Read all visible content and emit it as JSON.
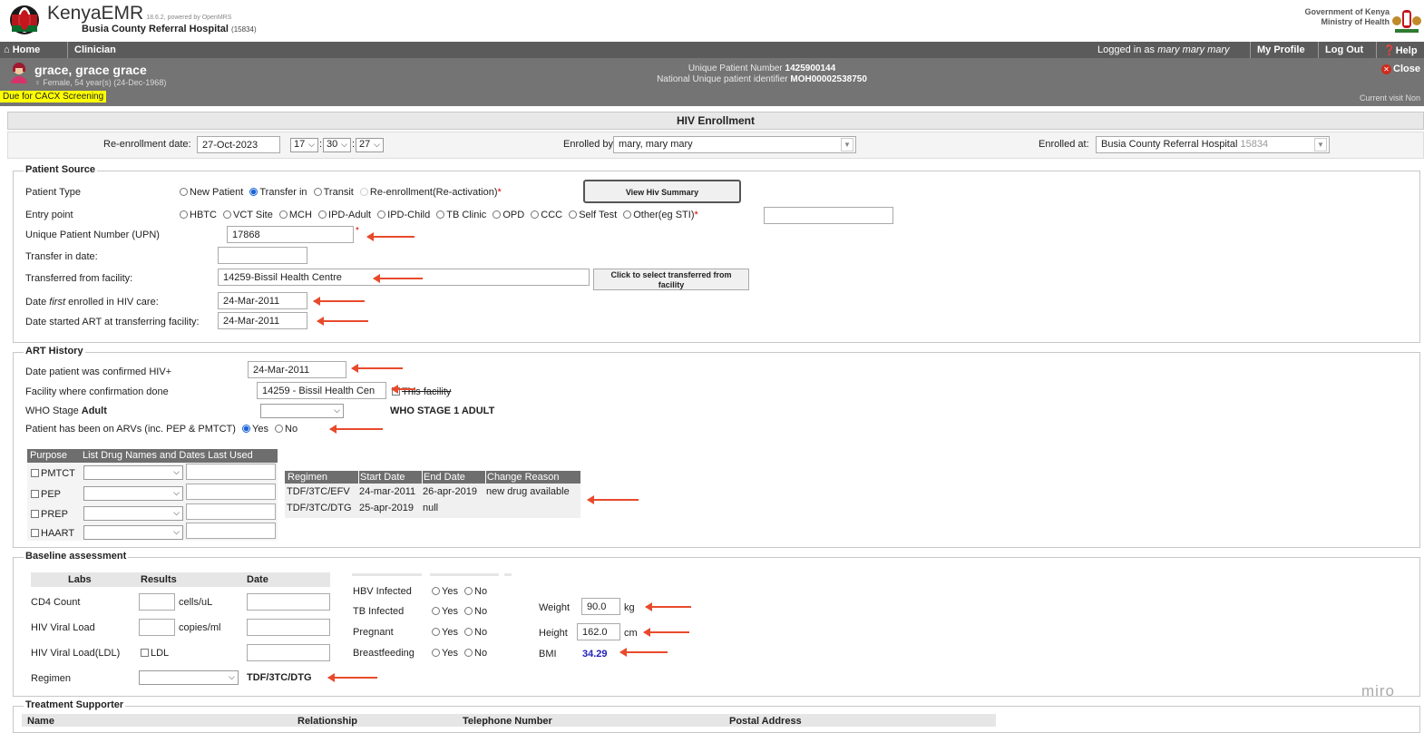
{
  "header": {
    "app_name": "KenyaEMR",
    "version": "18.6.2, powered by OpenMRS",
    "hospital": "Busia County Referral Hospital",
    "hospital_code": "(15834)",
    "gov_line1": "Government of Kenya",
    "gov_line2": "Ministry of Health"
  },
  "nav": {
    "home": "Home",
    "clinician": "Clinician",
    "logged_in_prefix": "Logged in as",
    "user": "mary mary mary",
    "my_profile": "My Profile",
    "logout": "Log Out",
    "help": "Help"
  },
  "patient": {
    "name": "grace, grace grace",
    "demographics": "Female, 54 year(s) (24-Dec-1968)",
    "upn_label": "Unique Patient Number",
    "upn_value": "1425900144",
    "nupi_label": "National Unique patient identifier",
    "nupi_value": "MOH00002538750",
    "alert": "Due for CACX Screening",
    "close": "Close",
    "current_visit": "Current visit Non"
  },
  "form": {
    "title": "HIV Enrollment",
    "reenroll_label": "Re-enrollment date:",
    "reenroll_date": "27-Oct-2023",
    "hour": "17",
    "minute": "30",
    "second": "27",
    "enrolled_by_label": "Enrolled by:",
    "enrolled_by": "mary, mary mary",
    "enrolled_at_label": "Enrolled at:",
    "enrolled_at": "Busia County Referral Hospital",
    "enrolled_at_code": "15834"
  },
  "patient_source": {
    "legend": "Patient Source",
    "patient_type_label": "Patient Type",
    "types": [
      "New Patient",
      "Transfer in",
      "Transit",
      "Re-enrollment(Re-activation)"
    ],
    "req": "*",
    "view_summary": "View Hiv Summary",
    "entry_point_label": "Entry point",
    "entry_points": [
      "HBTC",
      "VCT Site",
      "MCH",
      "IPD-Adult",
      "IPD-Child",
      "TB Clinic",
      "OPD",
      "CCC",
      "Self Test",
      "Other(eg STI)"
    ],
    "upn_label": "Unique Patient Number (UPN)",
    "upn_value": "17868",
    "transfer_date_label": "Transfer in date:",
    "transfer_date": "",
    "transferred_from_label": "Transferred from facility:",
    "transferred_from": "14259-Bissil Health Centre",
    "select_facility_btn_1": "Click to select transferred from",
    "select_facility_btn_2": "facility",
    "first_enrolled_label_pre": "Date ",
    "first_enrolled_label_em": "first",
    "first_enrolled_label_post": " enrolled in HIV care:",
    "first_enrolled": "24-Mar-2011",
    "art_start_label": "Date started ART at transferring facility:",
    "art_start": "24-Mar-2011"
  },
  "art_history": {
    "legend": "ART History",
    "confirmed_label": "Date patient was confirmed HIV+",
    "confirmed": "24-Mar-2011",
    "facility_label": "Facility where confirmation done",
    "facility": "14259 - Bissil Health Cen",
    "this_facility": "This facility",
    "who_label": "WHO Stage",
    "who_label_bold": "Adult",
    "who_value": "WHO STAGE 1 ADULT",
    "arvs_label": "Patient has been on ARVs (inc. PEP & PMTCT)",
    "yes": "Yes",
    "no": "No",
    "drug_head_purpose": "Purpose",
    "drug_head_names": "List Drug Names and Dates Last Used",
    "purposes": [
      "PMTCT",
      "PEP",
      "PREP",
      "HAART"
    ],
    "regimen_headers": [
      "Regimen",
      "Start Date",
      "End Date",
      "Change Reason"
    ],
    "regimen_rows": [
      [
        "TDF/3TC/EFV",
        "24-mar-2011",
        "26-apr-2019",
        "new drug available"
      ],
      [
        "TDF/3TC/DTG",
        "25-apr-2019",
        "null",
        ""
      ]
    ]
  },
  "baseline": {
    "legend": "Baseline assessment",
    "labs_head": "Labs",
    "results_head": "Results",
    "date_head": "Date",
    "cd4": "CD4 Count",
    "cd4_unit": "cells/uL",
    "vl": "HIV Viral Load",
    "vl_unit": "copies/ml",
    "vl_ldl": "HIV Viral Load(LDL)",
    "ldl": "LDL",
    "regimen": "Regimen",
    "regimen_value": "TDF/3TC/DTG",
    "hbv": "HBV Infected",
    "tb": "TB Infected",
    "pregnant": "Pregnant",
    "breastfeeding": "Breastfeeding",
    "yes": "Yes",
    "no": "No",
    "weight_label": "Weight",
    "weight": "90.0",
    "weight_unit": "kg",
    "height_label": "Height",
    "height": "162.0",
    "height_unit": "cm",
    "bmi_label": "BMI",
    "bmi": "34.29"
  },
  "supporter": {
    "legend": "Treatment Supporter",
    "name": "Name",
    "relationship": "Relationship",
    "telephone": "Telephone Number",
    "postal": "Postal Address"
  },
  "watermark": "miro",
  "colors": {
    "nav": "#5b5b5b",
    "banner": "#747474",
    "annotation": "#e84a2c",
    "bmi": "#2222bb",
    "alert": "#ffff00"
  }
}
